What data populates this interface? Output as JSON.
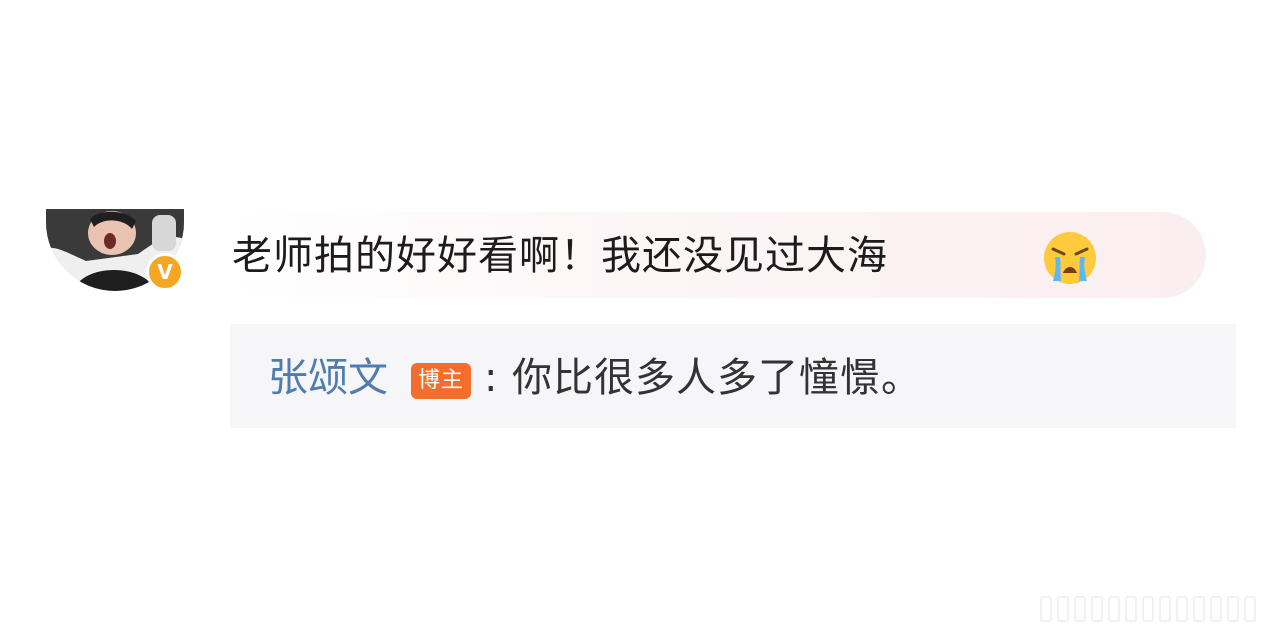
{
  "comment": {
    "avatar_icon": "user-avatar",
    "verified_icon": "verified-badge-icon",
    "verified_symbol": "V",
    "text": "老师拍的好好看啊！我还没见过大海",
    "emoji_icon": "crying-face-icon",
    "bubble_colors": [
      "#ffffff",
      "#fbeef0"
    ]
  },
  "reply": {
    "author": "张颂文",
    "author_tag": "博主",
    "separator": ":",
    "text": "你比很多人多了憧憬。",
    "author_color": "#4f7db0",
    "tag_color": "#f36d2c"
  }
}
